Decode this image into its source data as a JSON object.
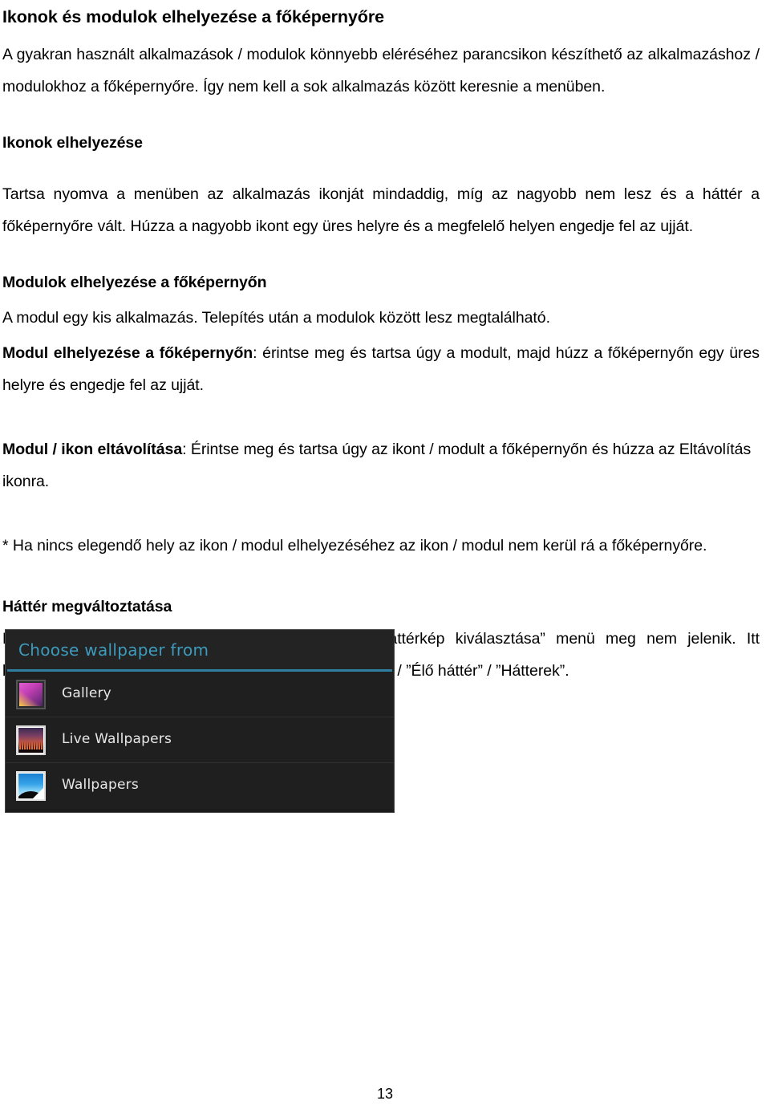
{
  "document": {
    "title": "Ikonok és modulok elhelyezése a főképernyőre",
    "intro": "A gyakran használt alkalmazások / modulok könnyebb eléréséhez parancsikon készíthető az alkalmazáshoz / modulokhoz a főképernyőre. Így nem kell a sok alkalmazás között keresnie a menüben.",
    "sections": [
      {
        "heading": "Ikonok elhelyezése",
        "body": "Tartsa nyomva a menüben az alkalmazás ikonját mindaddig, míg az nagyobb nem lesz és a háttér a főképernyőre vált. Húzza a nagyobb ikont egy üres helyre és a megfelelő helyen engedje fel az ujját."
      },
      {
        "heading": "Modulok elhelyezése a főképernyőn",
        "body": "A modul egy kis alkalmazás. Telepítés után a modulok között lesz megtalálható.",
        "lead_bold": "Modul elhelyezése a főképernyőn",
        "lead_rest": ": érintse meg és tartsa úgy a modult, majd húzz a főképernyőn egy üres helyre és engedje fel az ujját."
      }
    ],
    "remove_paragraph": {
      "lead_bold": "Modul / ikon eltávolítása",
      "rest": ": Érintse meg és tartsa úgy az ikont / modult a főképernyőn és húzza az Eltávolítás ikonra."
    },
    "footnote": "* Ha nincs elegendő hely az ikon / modul elhelyezéséhez az ikon / modul nem kerül rá a főképernyőre.",
    "wallpaper_section": {
      "heading": "Háttér megváltoztatása",
      "body": "Érintse meg a Főképernyő üres területét, amíg ”Háttérkép kiválasztása” menü meg nem jelenik. Itt kiválaszthatja a háttérképet az alábbi helyekről: ”Galéria” / ”Élő háttér” / ”Hátterek”."
    },
    "page_number": "13"
  },
  "android_dialog": {
    "title": "Choose wallpaper from",
    "title_color": "#3d9bbd",
    "rule_color": "#2e7fa0",
    "background_color": "#1c1c1c",
    "items": [
      {
        "label": "Gallery",
        "icon": "gallery-photo-icon"
      },
      {
        "label": "Live Wallpapers",
        "icon": "live-wallpaper-icon"
      },
      {
        "label": "Wallpapers",
        "icon": "wallpaper-photo-icon"
      }
    ]
  }
}
